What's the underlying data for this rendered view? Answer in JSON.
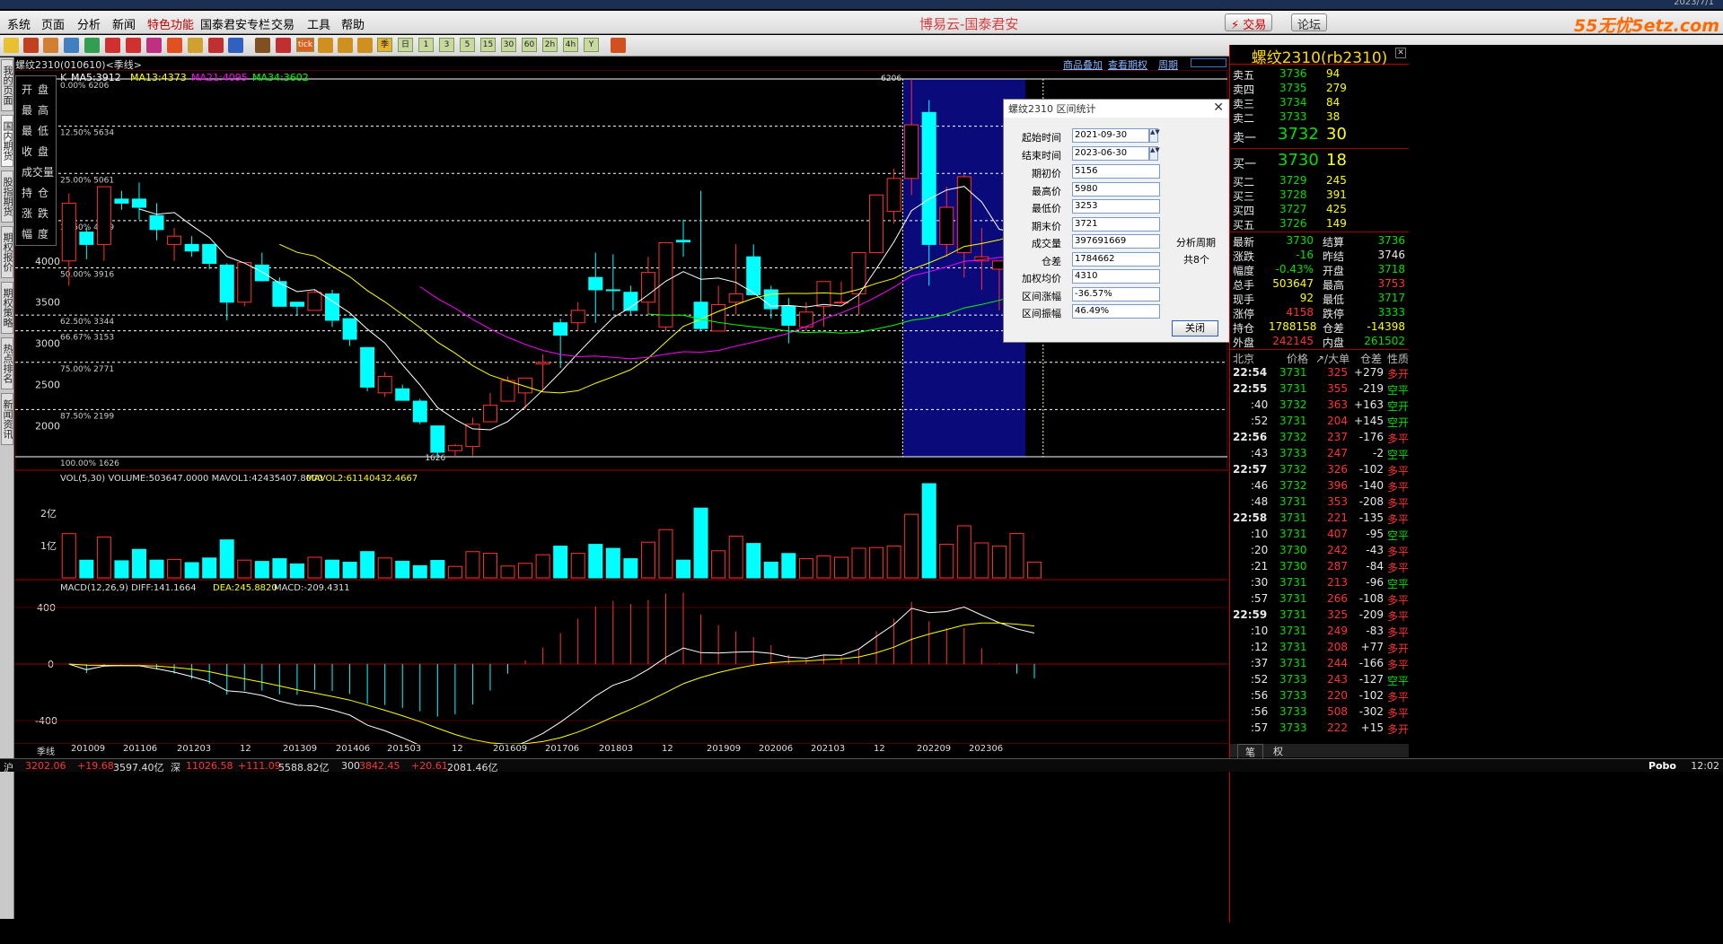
{
  "window": {
    "title": "博易云-国泰君安",
    "date": "2023/7/1"
  },
  "menu": [
    "系统",
    "页面",
    "分析",
    "新闻",
    "特色功能",
    "国泰君安专栏",
    "交易",
    "工具",
    "帮助"
  ],
  "menu_highlight": "特色功能",
  "top_buttons": {
    "trade": "⚡ 交易",
    "forum": "论坛"
  },
  "watermark": "55无忧5etz.com",
  "left_tabs": [
    "我的页面",
    "国内期货",
    "股指期货",
    "期权报价",
    "期权策略",
    "热点排名",
    "新闻资讯"
  ],
  "toolbar": {
    "periods": [
      "季",
      "日",
      "1",
      "3",
      "5",
      "15",
      "30",
      "60",
      "2h",
      "4h",
      "Y"
    ],
    "tick": "tick"
  },
  "chart": {
    "symbol_line": "螺纹2310(010610)<季线>",
    "k_label": "K",
    "ma_labels": [
      {
        "text": "MA5:3912",
        "color": "#ffffff"
      },
      {
        "text": "MA13:4373",
        "color": "#ffff00"
      },
      {
        "text": "MA21:4095",
        "color": "#ff00ff"
      },
      {
        "text": "MA34:3602",
        "color": "#00ff00"
      }
    ],
    "links": [
      "商品叠加",
      "查看期权",
      "周期"
    ],
    "ohlc_labels": [
      "开盘",
      "最高",
      "最低",
      "收盘",
      "成交量",
      "持仓",
      "涨跌",
      "幅度"
    ],
    "fib_levels": [
      {
        "label": "0.00%",
        "price": 6206
      },
      {
        "label": "12.50%",
        "price": 5634
      },
      {
        "label": "25.00%",
        "price": 5061
      },
      {
        "label": "37.50%",
        "price": 4489
      },
      {
        "label": "50.00%",
        "price": 3916
      },
      {
        "label": "62.50%",
        "price": 3344
      },
      {
        "label": "66.67%",
        "price": 3153
      },
      {
        "label": "75.00%",
        "price": 2771
      },
      {
        "label": "87.50%",
        "price": 2199
      },
      {
        "label": "100.00%",
        "price": 1626
      }
    ],
    "y_ticks": [
      4000,
      3500,
      3000,
      2500,
      2000
    ],
    "peak_label": "6206",
    "trough_label": "1626",
    "volume_header": "VOL(5,30) VOLUME:503647.0000  MAVOL1:42435407.8000",
    "volume_header2": "MAVOL2:61140432.4667",
    "volume_ticks": [
      "2亿",
      "1亿"
    ],
    "macd_header": "MACD(12,26,9)  DIFF:141.1664",
    "macd_dea": "DEA:245.8820",
    "macd_val": "MACD:-209.4311",
    "macd_ticks": [
      "400",
      "0",
      "-400"
    ],
    "x_labels": [
      "季线",
      "201009",
      "201106",
      "201203",
      "12",
      "201309",
      "201406",
      "201503",
      "12",
      "201609",
      "201706",
      "201803",
      "12",
      "201909",
      "202006",
      "202103",
      "12",
      "202209",
      "202306"
    ]
  },
  "chart_data": {
    "type": "candlestick",
    "period": "quarter",
    "series": [
      [
        4000,
        4820,
        3700,
        4700
      ],
      [
        4350,
        4400,
        4020,
        4200
      ],
      [
        4200,
        4900,
        4000,
        4900
      ],
      [
        4750,
        4850,
        4620,
        4700
      ],
      [
        4750,
        4950,
        4500,
        4650
      ],
      [
        4550,
        4700,
        4250,
        4380
      ],
      [
        4200,
        4400,
        4000,
        4300
      ],
      [
        4200,
        4300,
        4050,
        4120
      ],
      [
        4200,
        4200,
        3900,
        3970
      ],
      [
        3950,
        3970,
        3280,
        3500
      ],
      [
        3500,
        3900,
        3450,
        3980
      ],
      [
        3950,
        4100,
        3750,
        3760
      ],
      [
        3750,
        3800,
        3450,
        3450
      ],
      [
        3500,
        3500,
        3350,
        3450
      ],
      [
        3400,
        3650,
        3400,
        3620
      ],
      [
        3600,
        3650,
        3200,
        3280
      ],
      [
        3300,
        3300,
        2970,
        3050
      ],
      [
        2950,
        2950,
        2420,
        2470
      ],
      [
        2400,
        2650,
        2350,
        2600
      ],
      [
        2450,
        2500,
        2350,
        2310
      ],
      [
        2300,
        2330,
        2020,
        2050
      ],
      [
        2000,
        2000,
        1626,
        1680
      ],
      [
        1700,
        1780,
        1626,
        1760
      ],
      [
        1750,
        2100,
        1640,
        2020
      ],
      [
        2050,
        2400,
        2050,
        2250
      ],
      [
        2300,
        2600,
        2300,
        2550
      ],
      [
        2400,
        2500,
        2200,
        2580
      ],
      [
        2750,
        2870,
        2420,
        2770
      ],
      [
        3250,
        3300,
        2700,
        3100
      ],
      [
        3250,
        3500,
        3150,
        3400
      ],
      [
        3800,
        4100,
        3250,
        3650
      ],
      [
        3650,
        4080,
        3400,
        3640
      ],
      [
        3620,
        3700,
        3350,
        3400
      ],
      [
        3500,
        4050,
        3350,
        3860
      ],
      [
        3200,
        4100,
        3150,
        4220
      ],
      [
        4250,
        4500,
        4050,
        4230
      ],
      [
        3500,
        4850,
        3150,
        3180
      ],
      [
        3150,
        3700,
        3150,
        3470
      ],
      [
        3500,
        4200,
        3350,
        3600
      ],
      [
        4050,
        4200,
        3600,
        3590
      ],
      [
        3650,
        3700,
        3300,
        3420
      ],
      [
        3450,
        3550,
        3000,
        3220
      ],
      [
        3200,
        3500,
        3150,
        3380
      ],
      [
        3450,
        3550,
        3200,
        3750
      ],
      [
        3500,
        3750,
        3500,
        3500
      ],
      [
        3600,
        4100,
        3350,
        4100
      ],
      [
        4100,
        4800,
        4100,
        4800
      ],
      [
        4600,
        5120,
        4450,
        5000
      ],
      [
        5000,
        6206,
        4800,
        5650
      ],
      [
        5800,
        5950,
        3700,
        4200
      ],
      [
        4200,
        4900,
        4050,
        4650
      ],
      [
        4100,
        5050,
        3800,
        5020
      ],
      [
        4000,
        4400,
        3650,
        4050
      ],
      [
        3900,
        4000,
        3400,
        4000
      ],
      [
        4000,
        4200,
        3350,
        4000
      ],
      [
        3700,
        4100,
        3700,
        4110
      ]
    ],
    "ma5": 3912,
    "ma13": 4373,
    "ma21": 4095,
    "ma34": 3602,
    "ylim": [
      1626,
      6206
    ],
    "highlight_range": [
      "2021-09-30",
      "2023-06-30"
    ]
  },
  "stat_dialog": {
    "title": "螺纹2310 区间统计",
    "fields": [
      {
        "label": "起始时间",
        "value": "2021-09-30",
        "spin": true
      },
      {
        "label": "结束时间",
        "value": "2023-06-30",
        "spin": true
      },
      {
        "label": "期初价",
        "value": "5156"
      },
      {
        "label": "最高价",
        "value": "5980"
      },
      {
        "label": "最低价",
        "value": "3253"
      },
      {
        "label": "期末价",
        "value": "3721"
      },
      {
        "label": "成交量",
        "value": "397691669"
      },
      {
        "label": "仓差",
        "value": "1784662"
      },
      {
        "label": "加权均价",
        "value": "4310"
      },
      {
        "label": "区间涨幅",
        "value": "-36.57%"
      },
      {
        "label": "区间振幅",
        "value": "46.49%"
      }
    ],
    "period_label": "分析周期",
    "period_count": "共8个",
    "close_button": "关闭"
  },
  "quote": {
    "title": "螺纹2310(rb2310)",
    "asks": [
      {
        "label": "卖五",
        "price": "3736",
        "vol": "94"
      },
      {
        "label": "卖四",
        "price": "3735",
        "vol": "279"
      },
      {
        "label": "卖三",
        "price": "3734",
        "vol": "84"
      },
      {
        "label": "卖二",
        "price": "3733",
        "vol": "38"
      },
      {
        "label": "卖一",
        "price": "3732",
        "vol": "30"
      }
    ],
    "bids": [
      {
        "label": "买一",
        "price": "3730",
        "vol": "18"
      },
      {
        "label": "买二",
        "price": "3729",
        "vol": "245"
      },
      {
        "label": "买三",
        "price": "3728",
        "vol": "391"
      },
      {
        "label": "买四",
        "price": "3727",
        "vol": "425"
      },
      {
        "label": "买五",
        "price": "3726",
        "vol": "149"
      }
    ],
    "stats": [
      {
        "l1": "最新",
        "v1": "3730",
        "c1": "grn",
        "l2": "结算",
        "v2": "3736",
        "c2": "grn"
      },
      {
        "l1": "涨跌",
        "v1": "-16",
        "c1": "grn",
        "l2": "昨结",
        "v2": "3746",
        "c2": "wht"
      },
      {
        "l1": "幅度",
        "v1": "-0.43%",
        "c1": "grn",
        "l2": "开盘",
        "v2": "3718",
        "c2": "grn"
      },
      {
        "l1": "总手",
        "v1": "503647",
        "c1": "yel",
        "l2": "最高",
        "v2": "3753",
        "c2": "red"
      },
      {
        "l1": "现手",
        "v1": "92",
        "c1": "yel",
        "l2": "最低",
        "v2": "3717",
        "c2": "grn"
      },
      {
        "l1": "涨停",
        "v1": "4158",
        "c1": "red",
        "l2": "跌停",
        "v2": "3333",
        "c2": "grn"
      },
      {
        "l1": "持仓",
        "v1": "1788158",
        "c1": "yel",
        "l2": "仓差",
        "v2": "-14398",
        "c2": "yel"
      },
      {
        "l1": "外盘",
        "v1": "242145",
        "c1": "red",
        "l2": "内盘",
        "v2": "261502",
        "c2": "grn"
      }
    ],
    "tick_header": {
      "c1": "北京",
      "c2": "价格",
      "c3": "↗/大单",
      "c4": "仓差",
      "c5": "性质"
    },
    "ticks": [
      {
        "t": "22:54",
        "p": "3731",
        "v": "325",
        "d": "+279",
        "n": "多开",
        "big": true
      },
      {
        "t": "22:55",
        "p": "3731",
        "v": "355",
        "d": "-219",
        "n": "空平",
        "big": true
      },
      {
        "t": ":40",
        "p": "3732",
        "v": "363",
        "d": "+163",
        "n": "空开",
        "big": false
      },
      {
        "t": ":52",
        "p": "3731",
        "v": "204",
        "d": "+145",
        "n": "空开",
        "big": false
      },
      {
        "t": "22:56",
        "p": "3732",
        "v": "237",
        "d": "-176",
        "n": "多平",
        "big": true
      },
      {
        "t": ":43",
        "p": "3733",
        "v": "247",
        "d": "-2",
        "n": "空平",
        "big": false
      },
      {
        "t": "22:57",
        "p": "3732",
        "v": "326",
        "d": "-102",
        "n": "多平",
        "big": true
      },
      {
        "t": ":46",
        "p": "3732",
        "v": "396",
        "d": "-140",
        "n": "多平",
        "big": false
      },
      {
        "t": ":48",
        "p": "3731",
        "v": "353",
        "d": "-208",
        "n": "多平",
        "big": false
      },
      {
        "t": "22:58",
        "p": "3731",
        "v": "221",
        "d": "-135",
        "n": "多平",
        "big": true
      },
      {
        "t": ":10",
        "p": "3731",
        "v": "407",
        "d": "-95",
        "n": "空平",
        "big": false
      },
      {
        "t": ":20",
        "p": "3730",
        "v": "242",
        "d": "-43",
        "n": "多平",
        "big": false
      },
      {
        "t": ":21",
        "p": "3730",
        "v": "287",
        "d": "-84",
        "n": "多平",
        "big": false
      },
      {
        "t": ":30",
        "p": "3731",
        "v": "213",
        "d": "-96",
        "n": "空平",
        "big": false
      },
      {
        "t": ":57",
        "p": "3731",
        "v": "266",
        "d": "-108",
        "n": "多平",
        "big": false
      },
      {
        "t": "22:59",
        "p": "3731",
        "v": "325",
        "d": "-209",
        "n": "多平",
        "big": true
      },
      {
        "t": ":10",
        "p": "3731",
        "v": "249",
        "d": "-83",
        "n": "多平",
        "big": false
      },
      {
        "t": ":12",
        "p": "3731",
        "v": "208",
        "d": "+77",
        "n": "多开",
        "big": false
      },
      {
        "t": ":37",
        "p": "3731",
        "v": "244",
        "d": "-166",
        "n": "多平",
        "big": false
      },
      {
        "t": ":52",
        "p": "3733",
        "v": "243",
        "d": "-127",
        "n": "空平",
        "big": false
      },
      {
        "t": ":56",
        "p": "3733",
        "v": "220",
        "d": "-102",
        "n": "多平",
        "big": false
      },
      {
        "t": ":56",
        "p": "3733",
        "v": "508",
        "d": "-302",
        "n": "多平",
        "big": false
      },
      {
        "t": ":57",
        "p": "3733",
        "v": "222",
        "d": "+15",
        "n": "多开",
        "big": false
      }
    ],
    "bottom_tabs": [
      "笔",
      "权"
    ]
  },
  "statusbar": [
    {
      "text": "沪",
      "color": "#ddd"
    },
    {
      "text": "3202.06",
      "color": "#ff3333"
    },
    {
      "text": "+19.68",
      "color": "#ff3333"
    },
    {
      "text": "3597.40亿",
      "color": "#ddd"
    },
    {
      "text": "深",
      "color": "#ddd"
    },
    {
      "text": "11026.58",
      "color": "#ff3333"
    },
    {
      "text": "+111.09",
      "color": "#ff3333"
    },
    {
      "text": "5588.82亿",
      "color": "#ddd"
    },
    {
      "text": "300",
      "color": "#ddd"
    },
    {
      "text": "3842.45",
      "color": "#ff3333"
    },
    {
      "text": "+20.61",
      "color": "#ff3333"
    },
    {
      "text": "2081.46亿",
      "color": "#ddd"
    }
  ],
  "status_right": {
    "brand": "Pobo",
    "time": "12:02"
  }
}
